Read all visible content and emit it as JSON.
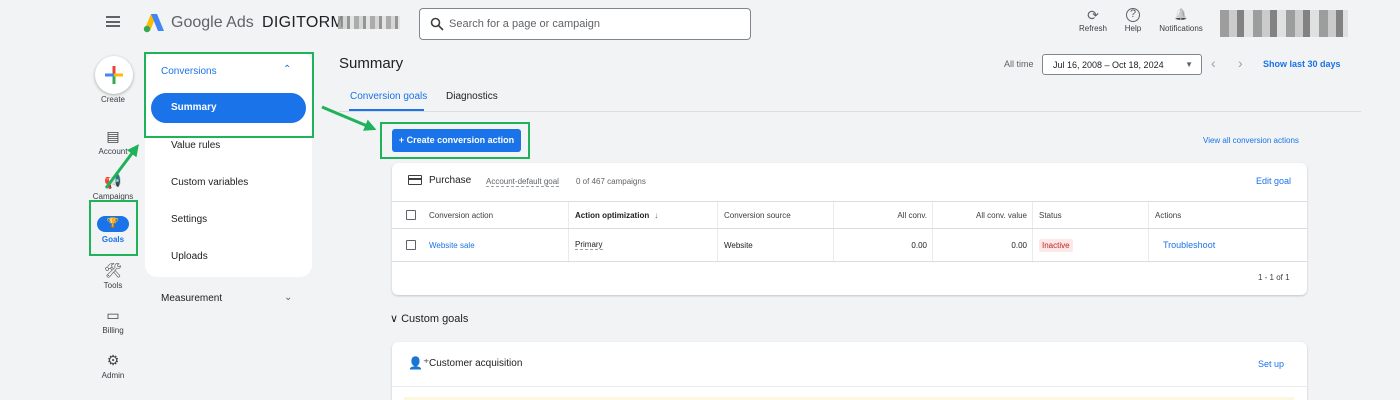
{
  "header": {
    "brand": "Google Ads",
    "account_name": "DIGITORM",
    "search_placeholder": "Search for a page or campaign",
    "actions": [
      {
        "label": "Refresh",
        "icon": "refresh-icon",
        "glyph": "⟳"
      },
      {
        "label": "Help",
        "icon": "help-icon",
        "glyph": "?"
      },
      {
        "label": "Notifications",
        "icon": "bell-icon",
        "glyph": "🔔"
      }
    ]
  },
  "rail": {
    "create": "Create",
    "account": "Account",
    "campaigns": "Campaigns",
    "goals": "Goals",
    "tools": "Tools",
    "billing": "Billing",
    "admin": "Admin"
  },
  "subnav": {
    "section": "Conversions",
    "items": [
      "Summary",
      "Value rules",
      "Custom variables",
      "Settings",
      "Uploads"
    ],
    "measurement": "Measurement"
  },
  "main": {
    "title": "Summary",
    "tabs": [
      "Conversion goals",
      "Diagnostics"
    ],
    "date_label": "All time",
    "date_range": "Jul 16, 2008 – Oct 18, 2024",
    "show_last": "Show last 30 days",
    "create_action": "+ Create conversion action",
    "view_all": "View all conversion actions"
  },
  "purchase_card": {
    "title": "Purchase",
    "subtitle": "Account-default goal",
    "count": "0 of 467 campaigns",
    "edit": "Edit goal",
    "columns": [
      "Conversion action",
      "Action optimization",
      "Conversion source",
      "All conv.",
      "All conv. value",
      "Status",
      "Actions"
    ],
    "sort_indicator": "↓",
    "rows": [
      {
        "action": "Website sale",
        "optimization": "Primary",
        "source": "Website",
        "all_conv": "0.00",
        "all_conv_value": "0.00",
        "status": "Inactive",
        "action_link": "Troubleshoot"
      }
    ],
    "pager": "1 - 1 of 1"
  },
  "custom_goals": {
    "label": "Custom goals",
    "card_title": "Customer acquisition",
    "setup": "Set up"
  },
  "colors": {
    "accent": "#1a73e8",
    "highlight": "#1fb25a",
    "inactive": "#c5221f"
  }
}
